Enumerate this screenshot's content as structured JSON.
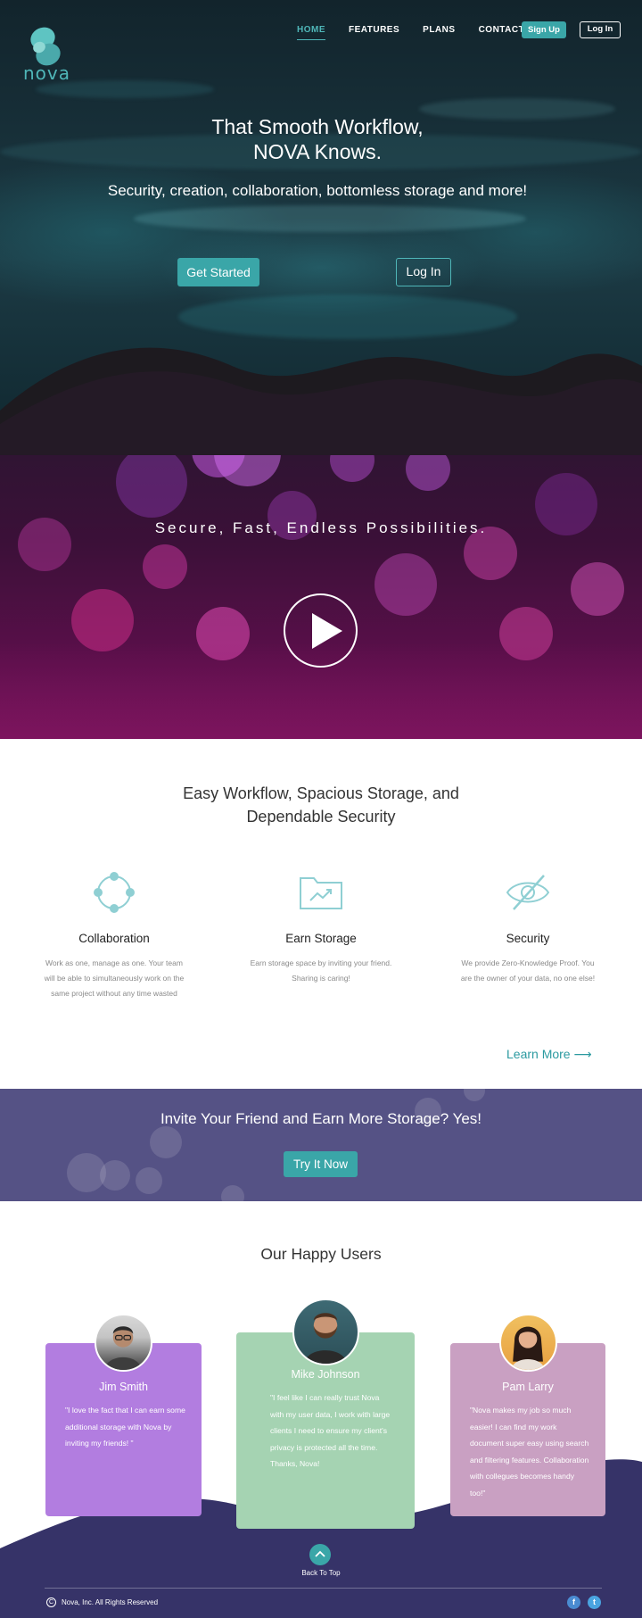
{
  "brand": {
    "name": "nova",
    "accent": "#3aa6a8"
  },
  "nav": {
    "items": [
      "HOME",
      "FEATURES",
      "PLANS",
      "CONTACT"
    ],
    "signup_label": "Sign Up",
    "login_label": "Log In"
  },
  "hero": {
    "title_line1": "That Smooth Workflow,",
    "title_line2": "NOVA Knows.",
    "subtitle": "Security, creation, collaboration, bottomless storage and more!",
    "get_started_label": "Get Started",
    "login_label": "Log In"
  },
  "video": {
    "tagline": "Secure, Fast, Endless Possibilities."
  },
  "features": {
    "title_line1": "Easy Workflow, Spacious Storage, and",
    "title_line2": "Dependable Security",
    "items": [
      {
        "icon": "collaboration-icon",
        "title": "Collaboration",
        "text": "Work as one, manage as one. Your team will be able to simultaneously work on the same project without any time wasted"
      },
      {
        "icon": "folder-chart-icon",
        "title": "Earn Storage",
        "text": "Earn storage space by inviting your friend. Sharing is caring!"
      },
      {
        "icon": "eye-slash-icon",
        "title": "Security",
        "text": "We provide Zero-Knowledge Proof. You are the owner of your data, no one else!"
      }
    ],
    "learn_more_label": "Learn More ⟶"
  },
  "invite": {
    "title": "Invite Your Friend and Earn More Storage? Yes!",
    "button_label": "Try It Now"
  },
  "users": {
    "title": "Our Happy Users",
    "testimonials": [
      {
        "name": "Jim Smith",
        "quote": "\"I love the fact that I can earn some additional storage with Nova by inviting my friends! \"",
        "color": "#b27de0"
      },
      {
        "name": "Mike Johnson",
        "quote": "\"I feel like I can really trust Nova with my user data, I work with large clients I need to ensure my client's privacy is protected all the time. Thanks, Nova!",
        "color": "#a5d3b2"
      },
      {
        "name": "Pam Larry",
        "quote": "\"Nova makes my job so much easier! I can find my work document super easy using search and filtering features. Collaboration with collegues becomes handy too!\"",
        "color": "#c9a0c2"
      }
    ]
  },
  "footer": {
    "back_to_top": "Back To Top",
    "copyright": "Nova, Inc. All Rights Reserved",
    "social": [
      "f",
      "t"
    ],
    "background": "#363368"
  }
}
